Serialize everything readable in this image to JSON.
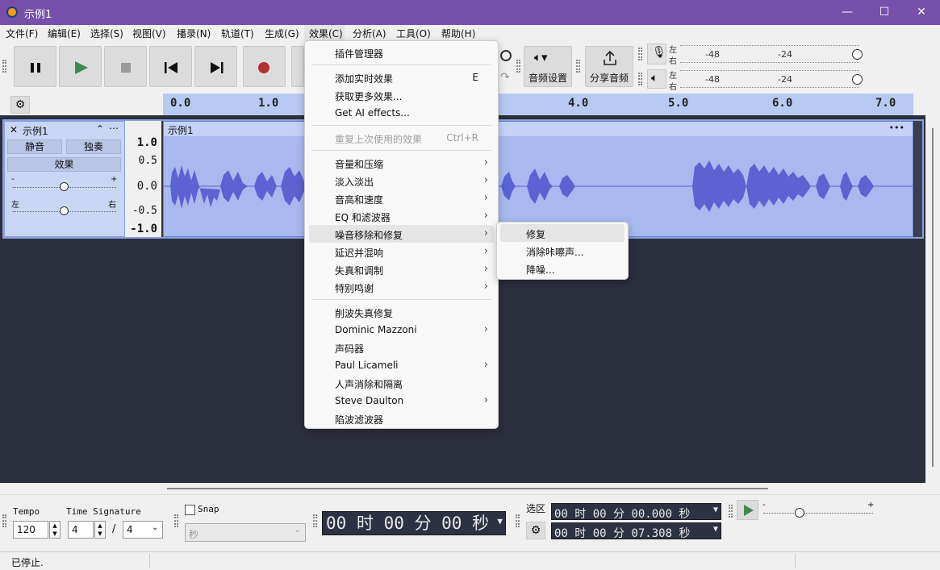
{
  "window": {
    "title": "示例1",
    "minimize": "—",
    "maximize": "☐",
    "close": "✕"
  },
  "menubar": [
    "文件(F)",
    "编辑(E)",
    "选择(S)",
    "视图(V)",
    "播录(N)",
    "轨道(T)",
    "生成(G)",
    "效果(C)",
    "分析(A)",
    "工具(O)",
    "帮助(H)"
  ],
  "toolbar": {
    "transport": [
      "pause",
      "play",
      "stop",
      "skip-start",
      "skip-end",
      "record"
    ],
    "audio_setup_label": "音频设置",
    "share_label": "分享音频",
    "meters": {
      "lr_top": "左",
      "lr_bottom": "右",
      "scale_48": "-48",
      "scale_24": "-24"
    }
  },
  "ruler": {
    "ticks": [
      "0.0",
      "1.0",
      "4.0",
      "5.0",
      "6.0",
      "7.0"
    ]
  },
  "track": {
    "name": "示例1",
    "mute": "静音",
    "solo": "独奏",
    "effects": "效果",
    "gain_min": "-",
    "gain_max": "+",
    "pan_left": "左",
    "pan_right": "右",
    "scale": [
      "1.0",
      "0.5",
      "0.0",
      "-0.5",
      "-1.0"
    ],
    "clip_name": "示例1",
    "clip_menu": "•••"
  },
  "effects_menu": {
    "items": [
      {
        "label": "插件管理器"
      },
      {
        "sep": true
      },
      {
        "label": "添加实时效果",
        "shortcut": "E"
      },
      {
        "label": "获取更多效果..."
      },
      {
        "label": "Get AI effects..."
      },
      {
        "sep": true
      },
      {
        "label": "重复上次使用的效果",
        "shortcut": "Ctrl+R",
        "disabled": true
      },
      {
        "sep": true
      },
      {
        "label": "音量和压缩",
        "submenu": true
      },
      {
        "label": "淡入淡出",
        "submenu": true
      },
      {
        "label": "音高和速度",
        "submenu": true
      },
      {
        "label": "EQ 和滤波器",
        "submenu": true
      },
      {
        "label": "噪音移除和修复",
        "submenu": true,
        "highlighted": true
      },
      {
        "label": "延迟并混响",
        "submenu": true
      },
      {
        "label": "失真和调制",
        "submenu": true
      },
      {
        "label": "特别鸣谢",
        "submenu": true
      },
      {
        "sep": true
      },
      {
        "label": "削波失真修复"
      },
      {
        "label": "Dominic Mazzoni",
        "submenu": true
      },
      {
        "label": "声码器"
      },
      {
        "label": "Paul Licameli",
        "submenu": true
      },
      {
        "label": "人声消除和隔离"
      },
      {
        "label": "Steve Daulton",
        "submenu": true
      },
      {
        "label": "陷波滤波器"
      }
    ]
  },
  "noise_submenu": {
    "items": [
      {
        "label": "修复",
        "highlighted": true
      },
      {
        "label": "消除咔嚓声..."
      },
      {
        "label": "降噪..."
      }
    ]
  },
  "bottom": {
    "tempo_label": "Tempo",
    "tempo_value": "120",
    "timesig_label": "Time Signature",
    "timesig_num": "4",
    "timesig_slash": "/",
    "timesig_den": "4",
    "snap_label": "Snap",
    "snap_unit": "秒",
    "time_display": "00 时 00 分 00 秒",
    "selection_label": "选区",
    "sel_start": "00 时 00 分 00.000 秒",
    "sel_end": "00 时 00 分 07.308 秒",
    "speed_min": "-",
    "speed_max": "+"
  },
  "status": {
    "text": "已停止."
  },
  "colors": {
    "titlebar": "#7650a9",
    "track_bg": "#2b2e3b",
    "waveform": "#5b63d3",
    "clip": "#a9b9ef",
    "ruler": "#b8c9f3",
    "record": "#b23030",
    "play": "#3e8a52"
  }
}
